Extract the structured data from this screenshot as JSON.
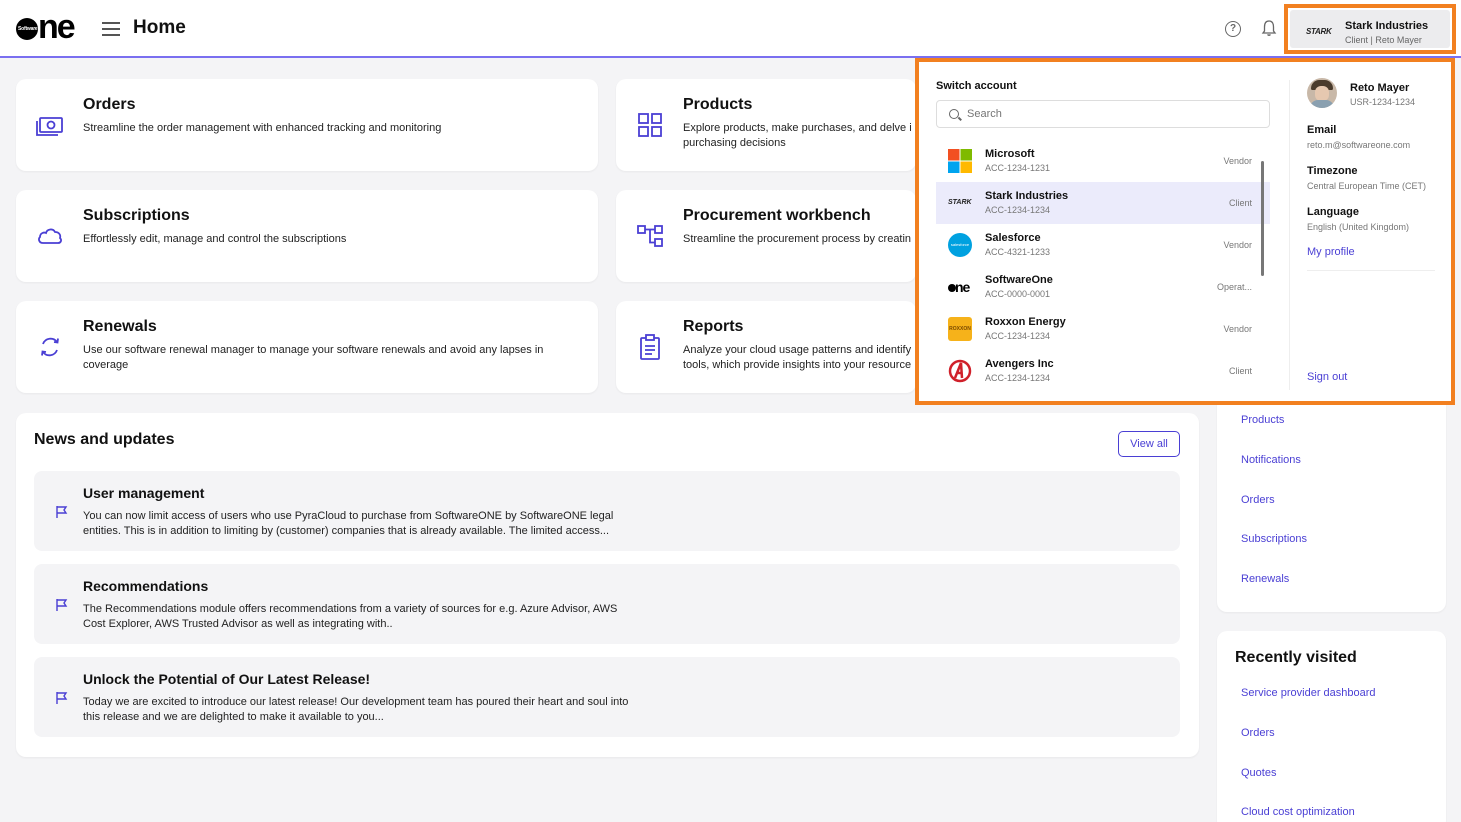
{
  "header": {
    "logo_text": "Software",
    "logo_brand": "ne",
    "title": "Home",
    "account": {
      "name": "Stark Industries",
      "subtitle": "Client | Reto Mayer",
      "logo_text": "STARK"
    }
  },
  "features": [
    {
      "title": "Orders",
      "description": "Streamline the order management with enhanced tracking and monitoring"
    },
    {
      "title": "Products",
      "description": "Explore products, make purchases, and delve i purchasing decisions"
    },
    {
      "title": "Subscriptions",
      "description": "Effortlessly edit, manage and control the subscriptions"
    },
    {
      "title": "Procurement workbench",
      "description": "Streamline the procurement process by creatin"
    },
    {
      "title": "Renewals",
      "description": "Use our software renewal manager to manage your software renewals and avoid any lapses in coverage"
    },
    {
      "title": "Reports",
      "description": "Analyze your cloud usage patterns and identify tools, which provide insights into your resource"
    }
  ],
  "news": {
    "heading": "News and updates",
    "view_all": "View all",
    "items": [
      {
        "title": "User management",
        "text": "You can now limit access of users who use PyraCloud to purchase from SoftwareONE by SoftwareONE legal entities. This is in addition to limiting by (customer) companies that is already available. The limited access..."
      },
      {
        "title": "Recommendations",
        "text": "The Recommendations module offers recommendations from a variety of sources for e.g. Azure Advisor, AWS Cost Explorer, AWS Trusted Advisor as well as integrating with.."
      },
      {
        "title": "Unlock the Potential of Our Latest Release!",
        "text": "Today we are excited to introduce our latest release! Our development team has poured their heart and soul into this release and we are delighted to make it available to you..."
      }
    ]
  },
  "side_links": [
    "Products",
    "Notifications",
    "Orders",
    "Subscriptions",
    "Renewals"
  ],
  "recently_visited": {
    "title": "Recently visited",
    "links": [
      "Service provider dashboard",
      "Orders",
      "Quotes",
      "Cloud cost optimization"
    ]
  },
  "switch_account": {
    "title": "Switch account",
    "search_placeholder": "Search",
    "accounts": [
      {
        "name": "Microsoft",
        "id": "ACC-1234-1231",
        "role": "Vendor"
      },
      {
        "name": "Stark Industries",
        "id": "ACC-1234-1234",
        "role": "Client"
      },
      {
        "name": "Salesforce",
        "id": "ACC-4321-1233",
        "role": "Vendor"
      },
      {
        "name": "SoftwareOne",
        "id": "ACC-0000-0001",
        "role": "Operat..."
      },
      {
        "name": "Roxxon Energy",
        "id": "ACC-1234-1234",
        "role": "Vendor"
      },
      {
        "name": "Avengers Inc",
        "id": "ACC-1234-1234",
        "role": "Client"
      }
    ],
    "logo_labels": {
      "stark": "STARK",
      "salesforce": "salesforce",
      "softwareone": "ne",
      "roxxon": "ROXXON"
    }
  },
  "profile": {
    "name": "Reto Mayer",
    "id": "USR-1234-1234",
    "email_label": "Email",
    "email": "reto.m@softwareone.com",
    "timezone_label": "Timezone",
    "timezone": "Central European Time (CET)",
    "language_label": "Language",
    "language": "English (United Kingdom)",
    "my_profile": "My profile",
    "sign_out": "Sign out"
  },
  "colors": {
    "accent": "#4a3fd4",
    "highlight": "#f28020",
    "header_line": "#7a6ff0"
  }
}
